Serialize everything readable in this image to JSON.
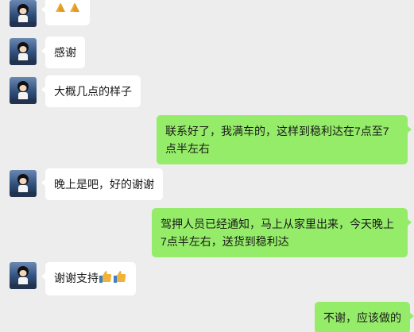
{
  "messages": [
    {
      "side": "in",
      "text": "",
      "emoji": [
        "folded-hands",
        "folded-hands"
      ]
    },
    {
      "side": "in",
      "text": "感谢"
    },
    {
      "side": "in",
      "text": "大概几点的样子"
    },
    {
      "side": "out",
      "text": "联系好了，我满车的，这样到稳利达在7点至7点半左右"
    },
    {
      "side": "in",
      "text": "晚上是吧，好的谢谢"
    },
    {
      "side": "out",
      "text": "驾押人员已经通知，马上从家里出来，今天晚上7点半左右，送货到稳利达"
    },
    {
      "side": "in",
      "text": "谢谢支持",
      "emoji": [
        "thumbs-up",
        "thumbs-up"
      ]
    },
    {
      "side": "out",
      "text": "不谢，应该做的"
    }
  ],
  "colors": {
    "background": "#ededed",
    "incoming_bubble": "#ffffff",
    "outgoing_bubble": "#95ec69"
  }
}
